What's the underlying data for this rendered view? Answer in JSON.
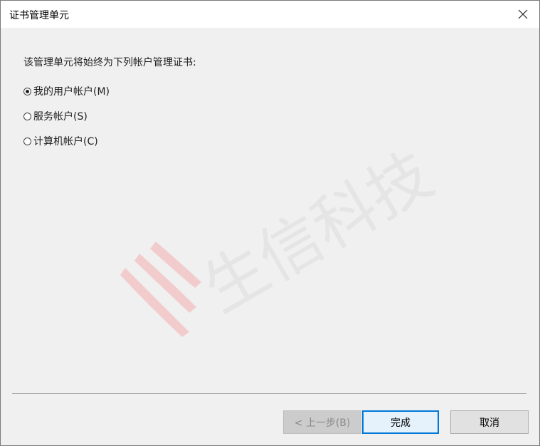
{
  "window": {
    "title": "证书管理单元",
    "close_icon": "close-icon"
  },
  "content": {
    "prompt": "该管理单元将始终为下列帐户管理证书:",
    "options": [
      {
        "label": "我的用户帐户(M)",
        "checked": true
      },
      {
        "label": "服务帐户(S)",
        "checked": false
      },
      {
        "label": "计算机帐户(C)",
        "checked": false
      }
    ]
  },
  "buttons": {
    "back": "< 上一步(B)",
    "finish": "完成",
    "cancel": "取消"
  },
  "watermark": {
    "text": "生信科技",
    "color": "#e8a3a3"
  },
  "colors": {
    "dialog_bg": "#f0f0f0",
    "accent": "#0078d7"
  }
}
